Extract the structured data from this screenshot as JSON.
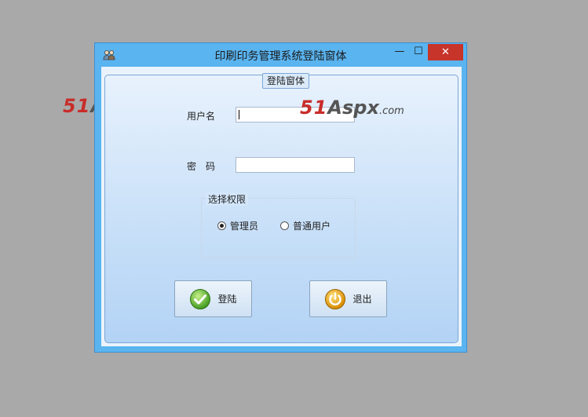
{
  "window": {
    "title": "印刷印务管理系统登陆窗体",
    "minimize_glyph": "—",
    "maximize_glyph": "☐",
    "close_glyph": "✕"
  },
  "form": {
    "group_caption": "登陆窗体",
    "username_label": "用户名",
    "username_value": "",
    "password_label": "密　码",
    "password_value": ""
  },
  "permission": {
    "caption": "选择权限",
    "options": [
      {
        "label": "管理员",
        "checked": true
      },
      {
        "label": "普通用户",
        "checked": false
      }
    ]
  },
  "buttons": {
    "login_label": "登陆",
    "exit_label": "退出"
  },
  "watermark": {
    "part1": "51",
    "part2": "Aspx",
    "part3": ".com"
  },
  "colors": {
    "titlebar": "#5ab4f0",
    "close_button": "#c7342a",
    "watermark_red": "#c82d2a"
  }
}
